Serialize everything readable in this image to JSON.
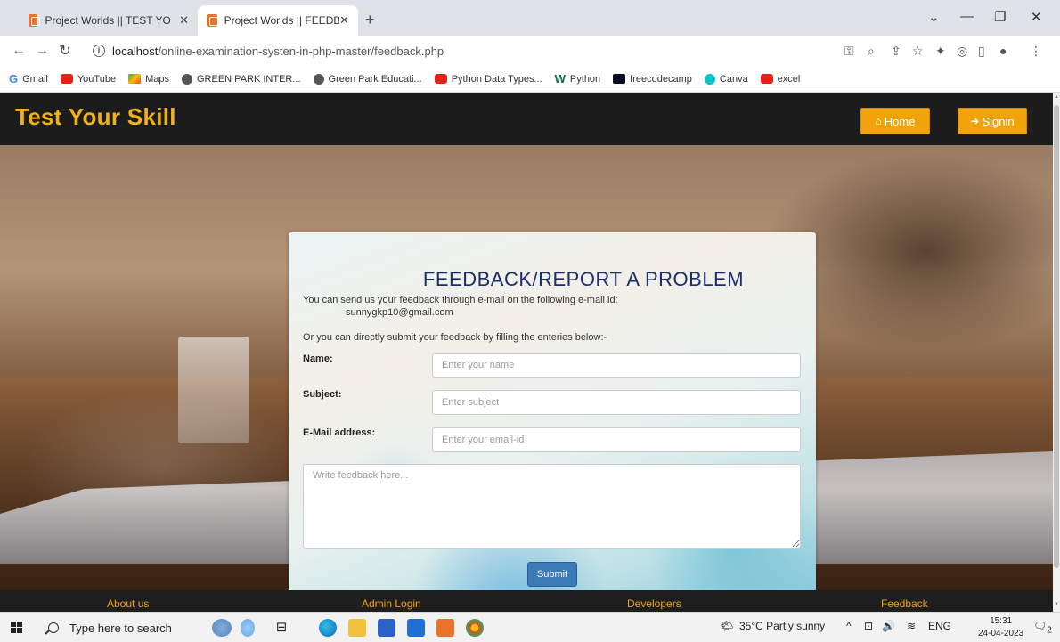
{
  "browser": {
    "tabs": [
      {
        "title": "Project Worlds || TEST YOUR SKIL",
        "active": false
      },
      {
        "title": "Project Worlds || FEEDBACK",
        "active": true
      }
    ],
    "url_host": "localhost",
    "url_path": "/online-examination-systen-in-php-master/feedback.php",
    "bookmarks": [
      "Gmail",
      "YouTube",
      "Maps",
      "GREEN PARK INTER...",
      "Green Park Educati...",
      "Python Data Types...",
      "Python",
      "freecodecamp",
      "Canva",
      "excel"
    ]
  },
  "site": {
    "brand": "Test Your Skill",
    "home_label": "Home",
    "signin_label": "Signin"
  },
  "feedback": {
    "title": "FEEDBACK/REPORT A PROBLEM",
    "intro": "You can send us your feedback through e-mail on the following e-mail id:",
    "email": "sunnygkp10@gmail.com",
    "direct_text": "Or you can directly submit your feedback by filling the enteries below:-",
    "name_label": "Name:",
    "name_placeholder": "Enter your name",
    "subject_label": "Subject:",
    "subject_placeholder": "Enter subject",
    "email_label": "E-Mail address:",
    "email_placeholder": "Enter your email-id",
    "feedback_placeholder": "Write feedback here...",
    "submit_label": "Submit"
  },
  "footer": {
    "links": [
      "About us",
      "Admin Login",
      "Developers",
      "Feedback"
    ]
  },
  "taskbar": {
    "search_placeholder": "Type here to search",
    "weather": "35°C  Partly sunny",
    "lang": "ENG",
    "time": "15:31",
    "date": "24-04-2023",
    "notif_count": "2"
  },
  "colors": {
    "brand": "#f0b214",
    "header_bg": "#1c1c1c",
    "button": "#f0a30a",
    "title": "#1d2e6b",
    "submit": "#3d7bb8"
  }
}
